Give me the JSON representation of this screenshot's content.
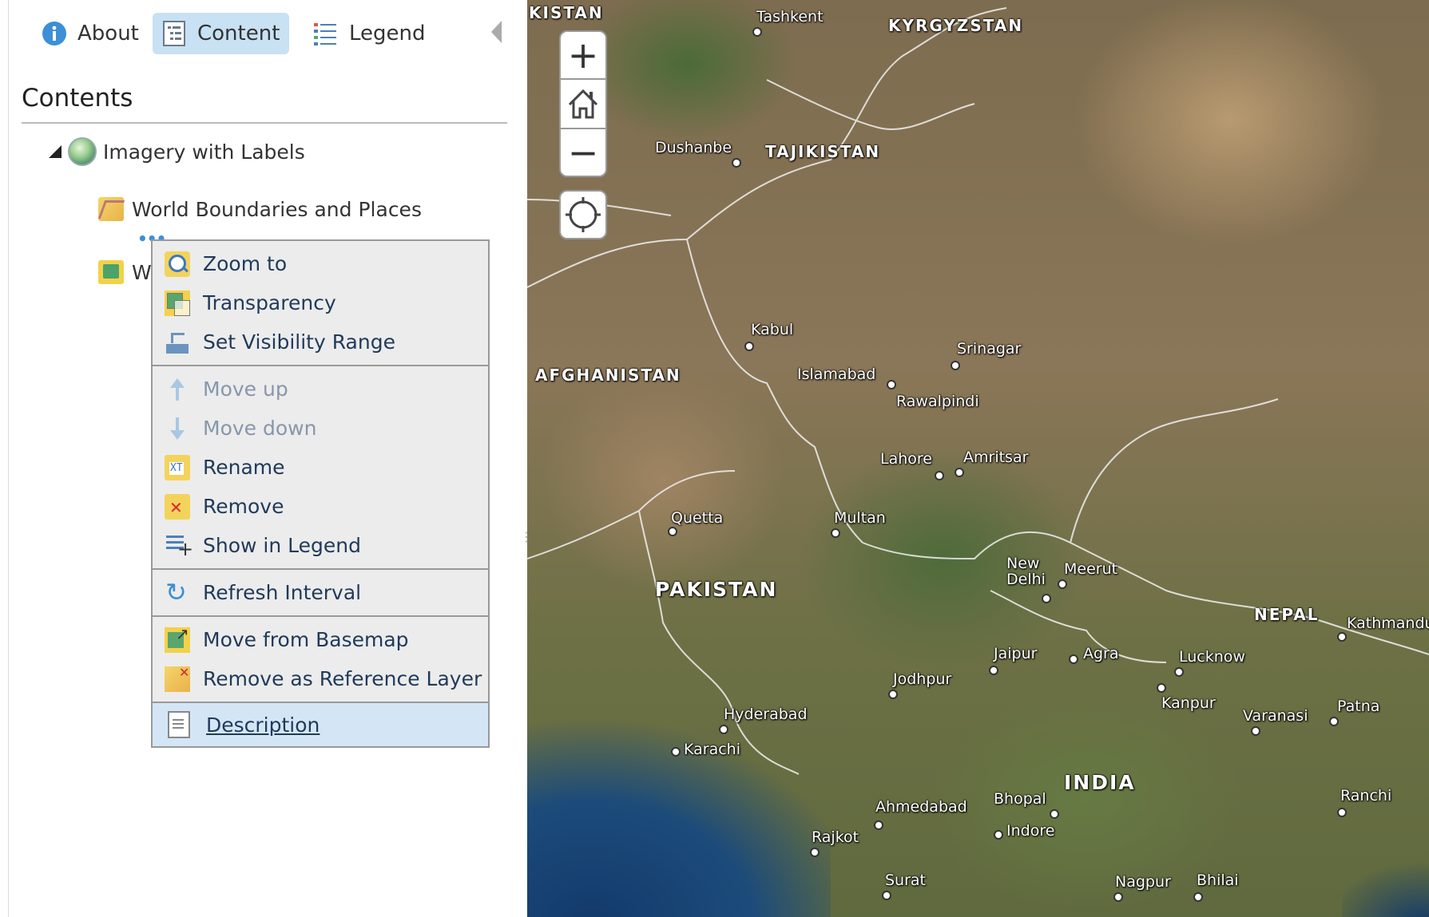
{
  "tabs": {
    "about": "About",
    "content": "Content",
    "legend": "Legend"
  },
  "contents": {
    "heading": "Contents",
    "basemap": "Imagery with Labels",
    "layers": [
      "World Boundaries and Places",
      "W"
    ]
  },
  "menu": {
    "groups": [
      [
        "Zoom to",
        "Transparency",
        "Set Visibility Range"
      ],
      [
        "Move up",
        "Move down",
        "Rename",
        "Remove",
        "Show in Legend"
      ],
      [
        "Refresh Interval"
      ],
      [
        "Move from Basemap",
        "Remove as Reference Layer"
      ],
      [
        "Description"
      ]
    ]
  },
  "map": {
    "controls": {
      "zoom_in": "+",
      "zoom_out": "−"
    },
    "labels": {
      "kistan": "KISTAN",
      "tashkent": "Tashkent",
      "kyrgyzstan": "KYRGYZSTAN",
      "dushanbe": "Dushanbe",
      "tajikistan": "TAJIKISTAN",
      "kabul": "Kabul",
      "afghanistan": "AFGHANISTAN",
      "islamabad": "Islamabad",
      "srinagar": "Srinagar",
      "rawalpindi": "Rawalpindi",
      "lahore": "Lahore",
      "amritsar": "Amritsar",
      "quetta": "Quetta",
      "multan": "Multan",
      "pakistan": "PAKISTAN",
      "new_delhi": "New\nDelhi",
      "meerut": "Meerut",
      "nepal": "NEPAL",
      "kathmandu": "Kathmandu",
      "jaipur": "Jaipur",
      "agra": "Agra",
      "lucknow": "Lucknow",
      "jodhpur": "Jodhpur",
      "kanpur": "Kanpur",
      "varanasi": "Varanasi",
      "patna": "Patna",
      "hyderabad": "Hyderabad",
      "karachi": "Karachi",
      "india": "INDIA",
      "bhopal": "Bhopal",
      "ahmedabad": "Ahmedabad",
      "indore": "Indore",
      "ranchi": "Ranchi",
      "rajkot": "Rajkot",
      "surat": "Surat",
      "nagpur": "Nagpur",
      "bhilai": "Bhilai"
    }
  },
  "colors": {
    "tab_active_bg": "#c8e1f3",
    "menu_bg": "#ececec",
    "menu_text": "#1f3a5a",
    "menu_disabled_text": "#8797ab",
    "menu_active_bg": "#d4e6f6"
  }
}
